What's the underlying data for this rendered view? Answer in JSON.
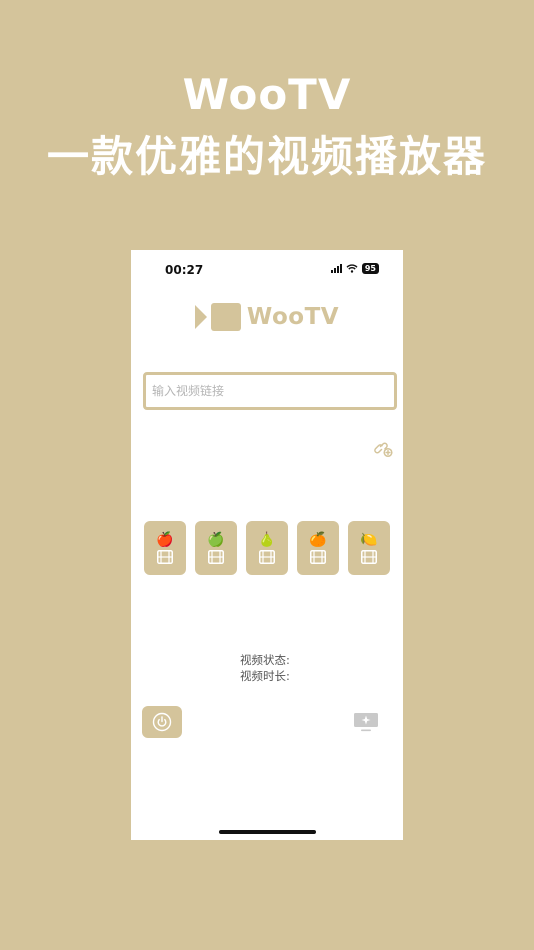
{
  "hero": {
    "title": "WooTV",
    "subtitle": "一款优雅的视频播放器"
  },
  "status_bar": {
    "time": "00:27",
    "battery": "95"
  },
  "brand": {
    "name": "WooTV",
    "logo_icon": "camera-icon"
  },
  "search": {
    "placeholder": "输入视频链接",
    "value": ""
  },
  "actions": {
    "link_icon": "link-add-icon",
    "power_icon": "power-icon",
    "cast_icon": "cast-screen-icon"
  },
  "sources": [
    {
      "glyph": "🍎",
      "icon": "apple-icon"
    },
    {
      "glyph": "🍏",
      "icon": "green-apple-icon"
    },
    {
      "glyph": "🍐",
      "icon": "pear-icon"
    },
    {
      "glyph": "🍊",
      "icon": "orange-icon"
    },
    {
      "glyph": "🍋",
      "icon": "lemon-icon"
    }
  ],
  "video_info": {
    "status_label": "视频状态:",
    "duration_label": "视频时长:"
  },
  "colors": {
    "accent": "#d4c49b",
    "background": "#d4c49b",
    "screen": "#ffffff"
  }
}
